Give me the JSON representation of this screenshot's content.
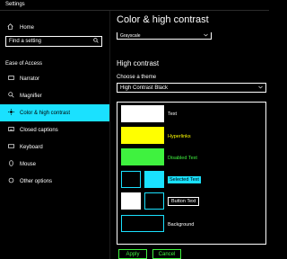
{
  "window": {
    "title": "Settings"
  },
  "sidebar": {
    "home_label": "Home",
    "search_placeholder": "Find a setting",
    "section_label": "Ease of Access",
    "items": [
      {
        "label": "Narrator",
        "icon": "narrator-icon"
      },
      {
        "label": "Magnifier",
        "icon": "magnifier-icon"
      },
      {
        "label": "Color & high contrast",
        "icon": "sun-icon",
        "active": true
      },
      {
        "label": "Closed captions",
        "icon": "captions-icon"
      },
      {
        "label": "Keyboard",
        "icon": "keyboard-icon"
      },
      {
        "label": "Mouse",
        "icon": "mouse-icon"
      },
      {
        "label": "Other options",
        "icon": "options-icon"
      }
    ]
  },
  "main": {
    "page_title": "Color & high contrast",
    "filter_value": "Grayscale",
    "high_contrast_heading": "High contrast",
    "theme_label": "Choose a theme",
    "theme_value": "High Contrast Black",
    "preview": {
      "text": "Text",
      "hyperlinks": "Hyperlinks",
      "disabled_text": "Disabled Text",
      "selected_text": "Selected Text",
      "button_text": "Button Text",
      "background": "Background"
    },
    "apply_label": "Apply",
    "cancel_label": "Cancel"
  },
  "colors": {
    "accent": "#1ae1ff",
    "hyperlink": "#ffff00",
    "disabled": "#3ff23f"
  }
}
